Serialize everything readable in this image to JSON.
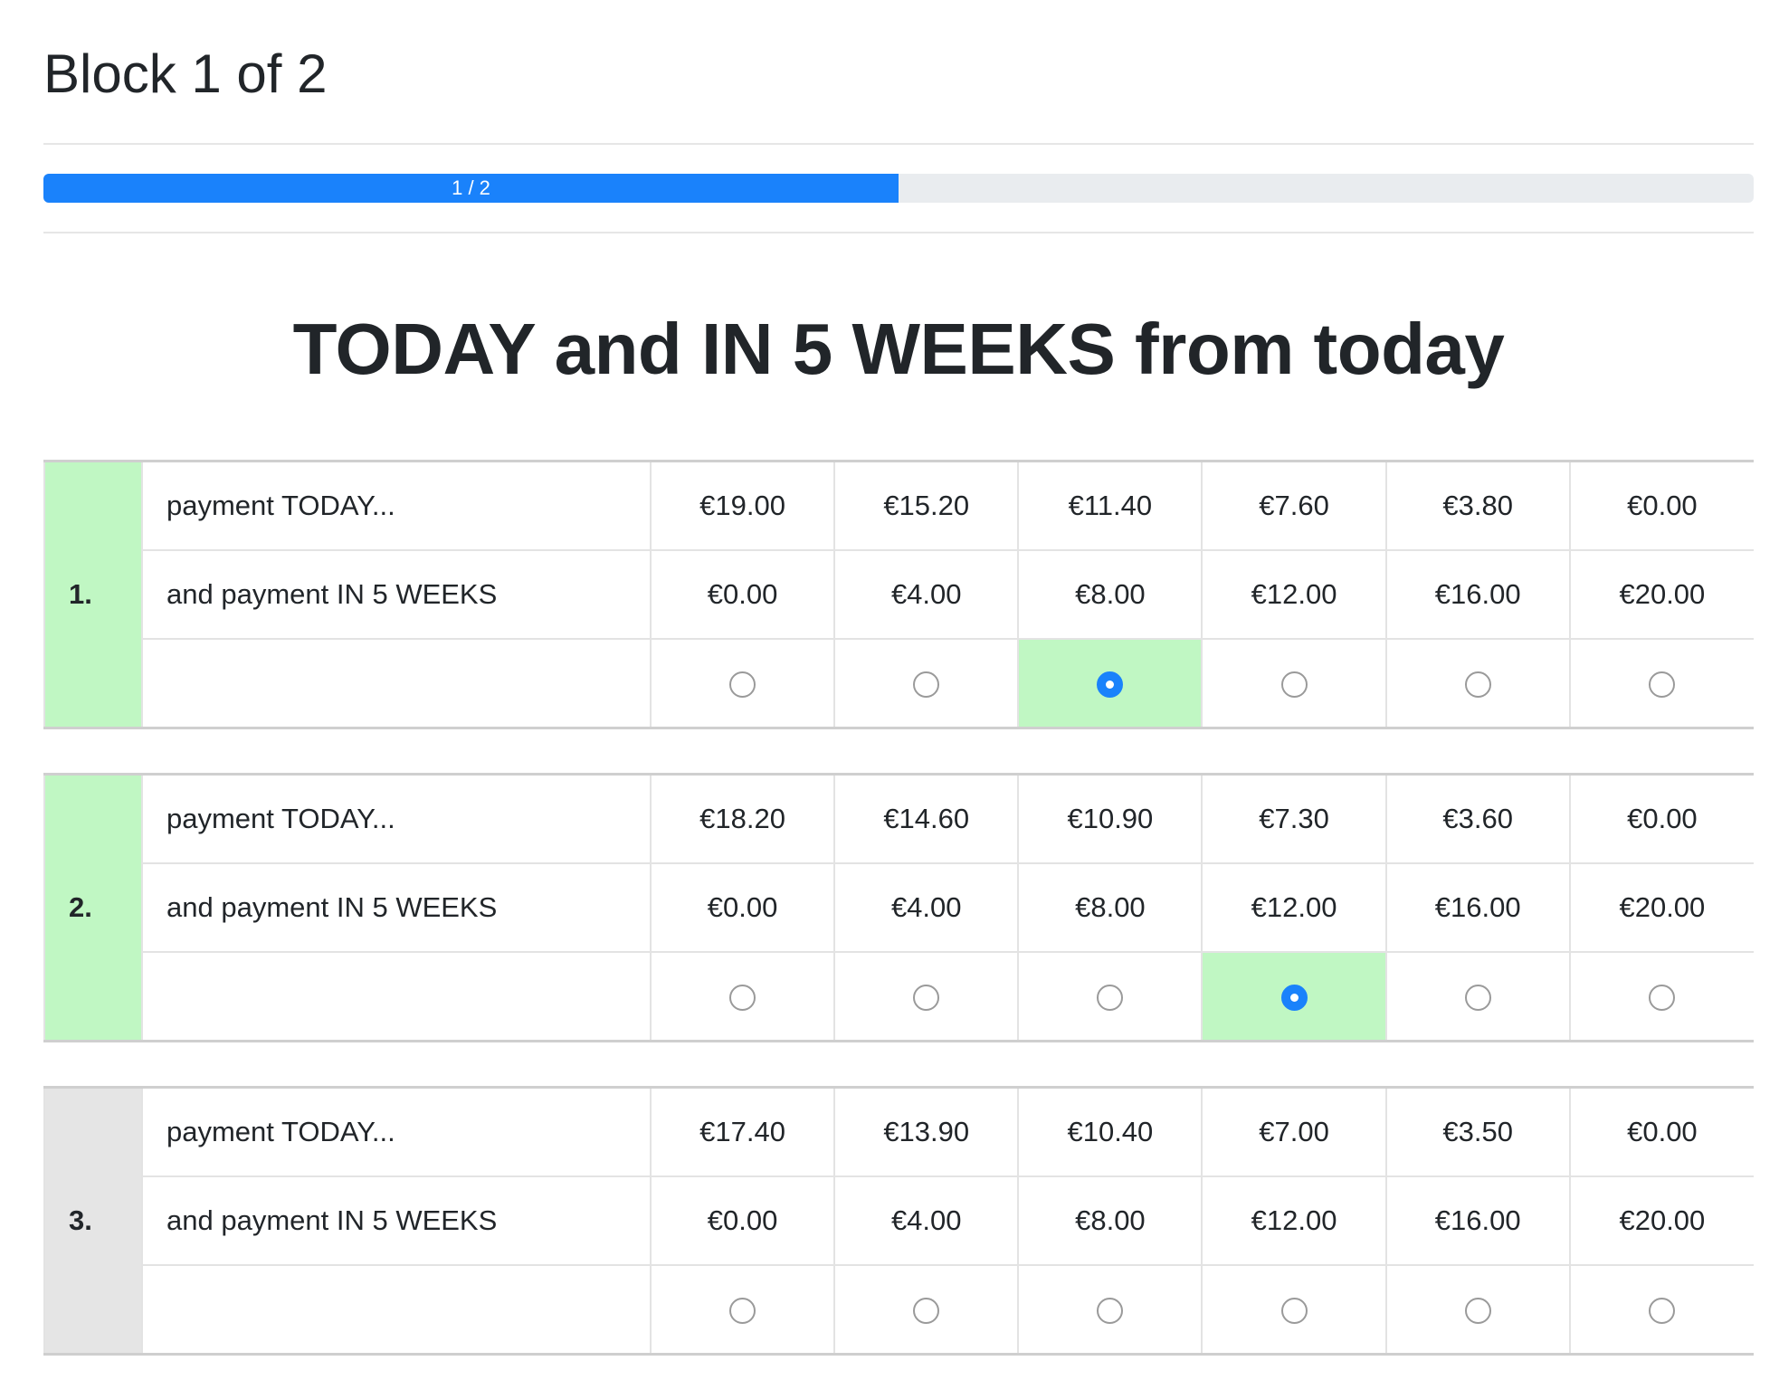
{
  "page": {
    "block_title": "Block 1 of 2",
    "progress": {
      "label": "1 / 2",
      "fraction": 0.5,
      "color": "#1a82fb"
    },
    "heading": "TODAY and IN 5 WEEKS from today"
  },
  "colors": {
    "answered": "#c0f7c3",
    "unanswered": "#e5e5e5",
    "radio_selected": "#1a82fb"
  },
  "questions": [
    {
      "number": "1.",
      "answered": true,
      "row_today_label": "payment TODAY...",
      "row_later_label": "and payment IN 5 WEEKS",
      "today_amounts": [
        "€19.00",
        "€15.20",
        "€11.40",
        "€7.60",
        "€3.80",
        "€0.00"
      ],
      "later_amounts": [
        "€0.00",
        "€4.00",
        "€8.00",
        "€12.00",
        "€16.00",
        "€20.00"
      ],
      "selected_index": 2
    },
    {
      "number": "2.",
      "answered": true,
      "row_today_label": "payment TODAY...",
      "row_later_label": "and payment IN 5 WEEKS",
      "today_amounts": [
        "€18.20",
        "€14.60",
        "€10.90",
        "€7.30",
        "€3.60",
        "€0.00"
      ],
      "later_amounts": [
        "€0.00",
        "€4.00",
        "€8.00",
        "€12.00",
        "€16.00",
        "€20.00"
      ],
      "selected_index": 3
    },
    {
      "number": "3.",
      "answered": false,
      "row_today_label": "payment TODAY...",
      "row_later_label": "and payment IN 5 WEEKS",
      "today_amounts": [
        "€17.40",
        "€13.90",
        "€10.40",
        "€7.00",
        "€3.50",
        "€0.00"
      ],
      "later_amounts": [
        "€0.00",
        "€4.00",
        "€8.00",
        "€12.00",
        "€16.00",
        "€20.00"
      ],
      "selected_index": null
    }
  ]
}
